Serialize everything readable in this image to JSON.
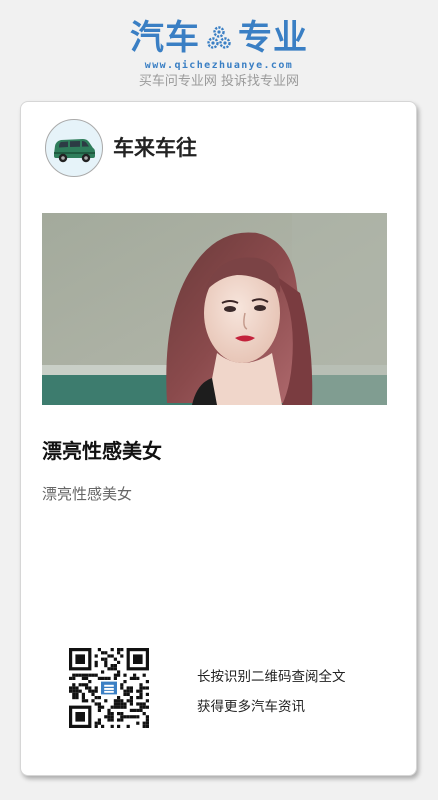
{
  "header": {
    "logo_title_left": "汽车",
    "logo_title_right": "专业",
    "logo_icon": "gear-icon",
    "logo_url": "www.qichezhuanye.com",
    "slogan": "买车问专业网 投诉找专业网"
  },
  "card": {
    "avatar_icon": "car-icon",
    "brand_name": "车来车往",
    "photo_icon": "woman-portrait-photo",
    "article_title": "漂亮性感美女",
    "article_summary": "漂亮性感美女",
    "qr_icon": "qr-code-icon",
    "qr_caption_line1": "长按识别二维码查阅全文",
    "qr_caption_line2": "获得更多汽车资讯"
  },
  "colors": {
    "brand_blue": "#3a7fc4",
    "page_background": "#f1f1f1",
    "card_background": "#ffffff"
  }
}
